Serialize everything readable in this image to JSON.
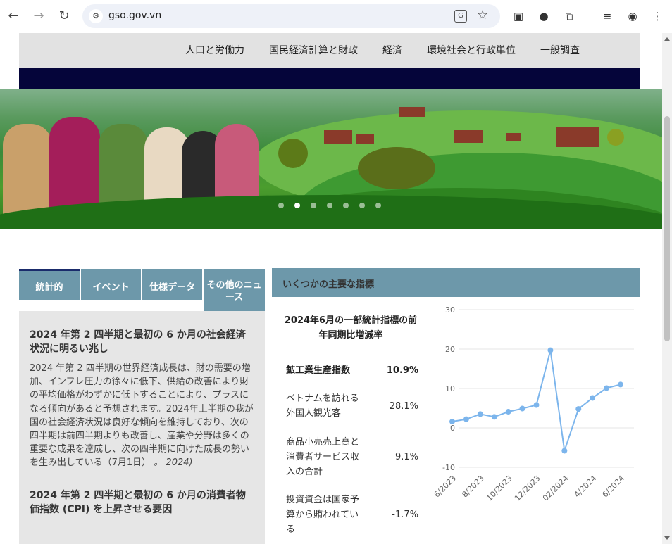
{
  "browser": {
    "url": "gso.gov.vn"
  },
  "menu": {
    "items": [
      "人口と労働力",
      "国民経済計算と財政",
      "経済",
      "環境社会と行政単位",
      "一般調査"
    ]
  },
  "tabs": [
    "統計的",
    "イベント",
    "仕様データ",
    "その他のニュース"
  ],
  "news": [
    {
      "title": "2024 年第 2 四半期と最初の 6 か月の社会経済状況に明るい兆し",
      "body": "2024 年第 2 四半期の世界経済成長は、財の需要の増加、インフレ圧力の徐々に低下、供給の改善により財の平均価格がわずかに低下することにより、プラスになる傾向があると予想されます。2024年上半期の我が国の社会経済状況は良好な傾向を維持しており、次の四半期は前四半期よりも改善し、産業や分野は多くの重要な成果を達成し、次の四半期に向けた成長の勢いを生み出している（7月1日）",
      "date": "。 2024)"
    },
    {
      "title": "2024 年第 2 四半期と最初の 6 か月の消費者物価指数 (CPI) を上昇させる要因"
    }
  ],
  "indicators": {
    "header": "いくつかの主要な指標",
    "title": "2024年6月の一部統計指標の前年同期比増減率",
    "rows": [
      {
        "label": "鉱工業生産指数",
        "value": "10.9%"
      },
      {
        "label": "ベトナムを訪れる外国人観光客",
        "value": "28.1%"
      },
      {
        "label": "商品小売売上高と消費者サービス収入の合計",
        "value": "9.1%"
      },
      {
        "label": "投資資金は国家予算から賄われている",
        "value": "-1.7%"
      }
    ]
  },
  "chart_data": {
    "type": "line",
    "x": [
      "6/2023",
      "7/2023",
      "8/2023",
      "9/2023",
      "10/2023",
      "11/2023",
      "12/2023",
      "01/2024",
      "02/2024",
      "03/2024",
      "4/2024",
      "5/2024",
      "6/2024"
    ],
    "tick_labels": [
      "6/2023",
      "8/2023",
      "10/2023",
      "12/2023",
      "02/2024",
      "4/2024",
      "6/2024"
    ],
    "values": [
      1.6,
      2.2,
      3.5,
      2.8,
      4.1,
      4.9,
      5.8,
      19.7,
      -5.8,
      4.8,
      7.6,
      10.1,
      11.0
    ],
    "ylim": [
      -10,
      30
    ],
    "yticks": [
      30,
      20,
      10,
      0,
      -10
    ],
    "color": "#7cb5ec",
    "grid": true
  }
}
